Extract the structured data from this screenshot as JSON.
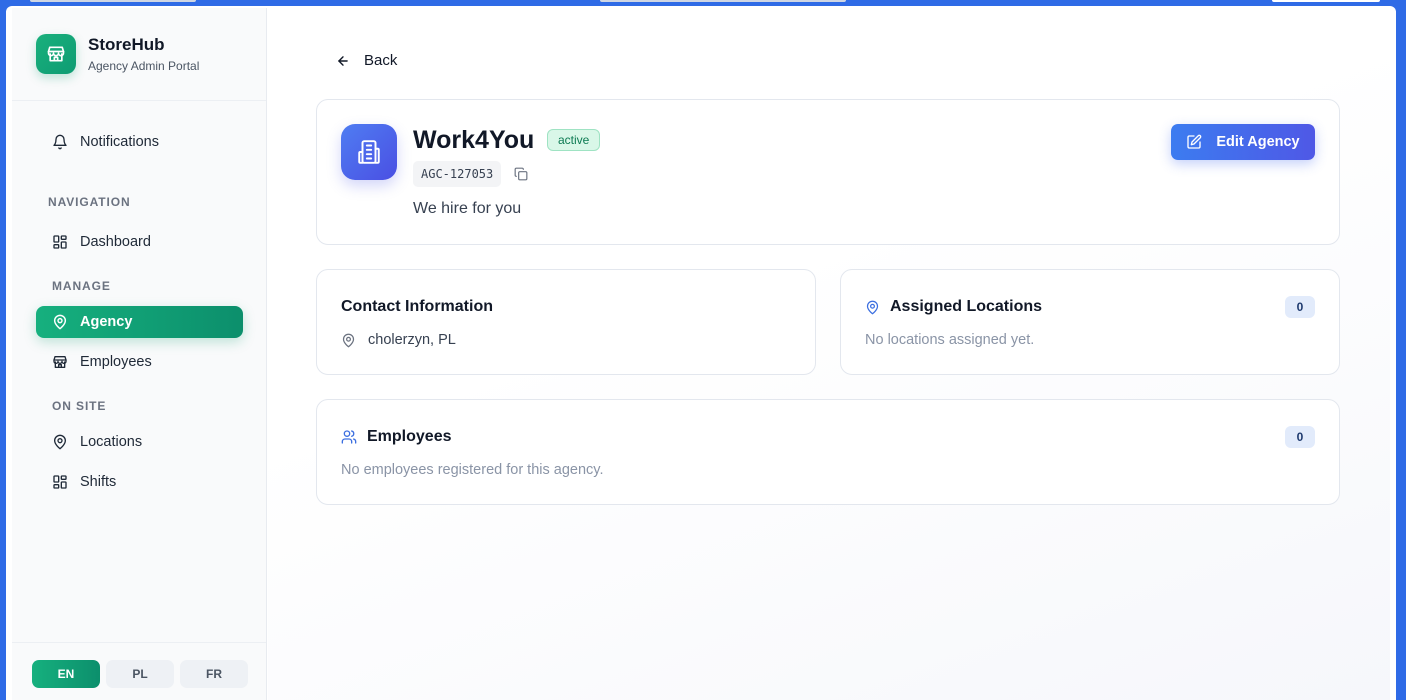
{
  "brand": {
    "name": "StoreHub",
    "subtitle": "Agency Admin Portal"
  },
  "sidebar": {
    "notifications_label": "Notifications",
    "sections": {
      "navigation": "NAVIGATION",
      "manage": "MANAGE",
      "on_site": "ON SITE"
    },
    "items": [
      {
        "label": "Dashboard",
        "icon": "dashboard-icon"
      },
      {
        "label": "Agency",
        "icon": "map-pin-icon",
        "active": true
      },
      {
        "label": "Employees",
        "icon": "store-icon"
      },
      {
        "label": "Locations",
        "icon": "map-pin-icon"
      },
      {
        "label": "Shifts",
        "icon": "dashboard-icon"
      }
    ]
  },
  "languages": [
    {
      "code": "EN",
      "active": true
    },
    {
      "code": "PL"
    },
    {
      "code": "FR"
    }
  ],
  "main": {
    "back_label": "Back",
    "agency": {
      "name": "Work4You",
      "status": "active",
      "code": "AGC-127053",
      "description": "We hire for you",
      "edit_label": "Edit Agency"
    },
    "contact": {
      "title": "Contact Information",
      "location": "cholerzyn, PL"
    },
    "assigned_locations": {
      "title": "Assigned Locations",
      "count": "0",
      "empty_text": "No locations assigned yet."
    },
    "employees": {
      "title": "Employees",
      "count": "0",
      "empty_text": "No employees registered for this agency."
    }
  },
  "colors": {
    "accent_green": "#16b07e",
    "accent_blue": "#3c7cf0",
    "frame_blue": "#2f6be6"
  }
}
